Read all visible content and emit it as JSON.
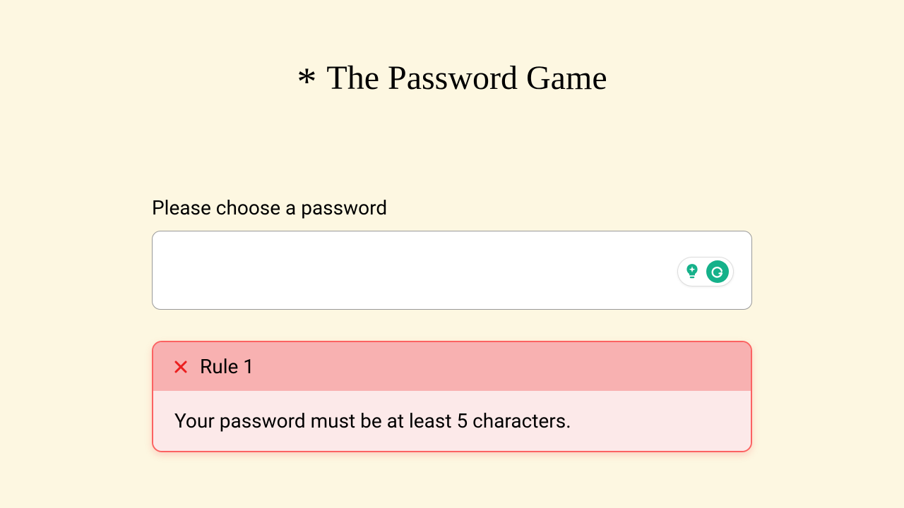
{
  "header": {
    "asterisk": "*",
    "title": "The Password Game"
  },
  "main": {
    "prompt": "Please choose a password",
    "password_value": ""
  },
  "rule": {
    "number_label": "Rule 1",
    "description": "Your password must be at least 5 characters.",
    "status": "fail"
  },
  "colors": {
    "background": "#fdf7e1",
    "rule_border": "#fb6262",
    "rule_header_bg": "#f8b1b1",
    "rule_body_bg": "#fce9e9",
    "grammarly_green": "#15b18a"
  }
}
